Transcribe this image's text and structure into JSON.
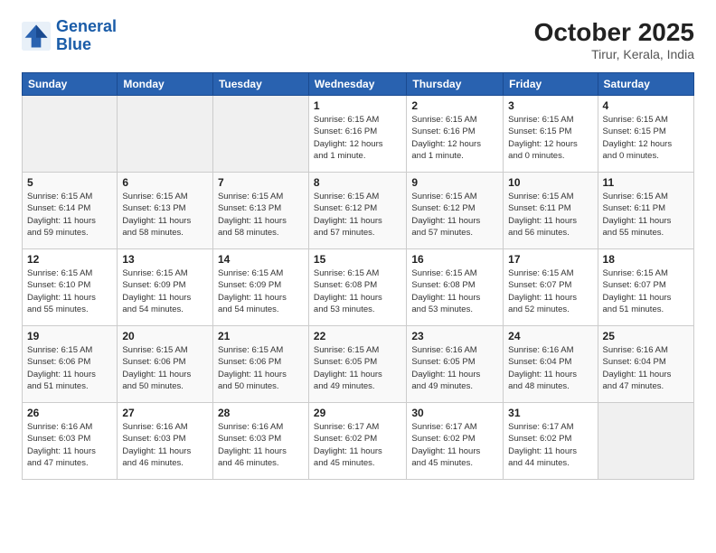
{
  "header": {
    "logo_line1": "General",
    "logo_line2": "Blue",
    "month": "October 2025",
    "location": "Tirur, Kerala, India"
  },
  "weekdays": [
    "Sunday",
    "Monday",
    "Tuesday",
    "Wednesday",
    "Thursday",
    "Friday",
    "Saturday"
  ],
  "weeks": [
    [
      {
        "day": "",
        "info": ""
      },
      {
        "day": "",
        "info": ""
      },
      {
        "day": "",
        "info": ""
      },
      {
        "day": "1",
        "info": "Sunrise: 6:15 AM\nSunset: 6:16 PM\nDaylight: 12 hours\nand 1 minute."
      },
      {
        "day": "2",
        "info": "Sunrise: 6:15 AM\nSunset: 6:16 PM\nDaylight: 12 hours\nand 1 minute."
      },
      {
        "day": "3",
        "info": "Sunrise: 6:15 AM\nSunset: 6:15 PM\nDaylight: 12 hours\nand 0 minutes."
      },
      {
        "day": "4",
        "info": "Sunrise: 6:15 AM\nSunset: 6:15 PM\nDaylight: 12 hours\nand 0 minutes."
      }
    ],
    [
      {
        "day": "5",
        "info": "Sunrise: 6:15 AM\nSunset: 6:14 PM\nDaylight: 11 hours\nand 59 minutes."
      },
      {
        "day": "6",
        "info": "Sunrise: 6:15 AM\nSunset: 6:13 PM\nDaylight: 11 hours\nand 58 minutes."
      },
      {
        "day": "7",
        "info": "Sunrise: 6:15 AM\nSunset: 6:13 PM\nDaylight: 11 hours\nand 58 minutes."
      },
      {
        "day": "8",
        "info": "Sunrise: 6:15 AM\nSunset: 6:12 PM\nDaylight: 11 hours\nand 57 minutes."
      },
      {
        "day": "9",
        "info": "Sunrise: 6:15 AM\nSunset: 6:12 PM\nDaylight: 11 hours\nand 57 minutes."
      },
      {
        "day": "10",
        "info": "Sunrise: 6:15 AM\nSunset: 6:11 PM\nDaylight: 11 hours\nand 56 minutes."
      },
      {
        "day": "11",
        "info": "Sunrise: 6:15 AM\nSunset: 6:11 PM\nDaylight: 11 hours\nand 55 minutes."
      }
    ],
    [
      {
        "day": "12",
        "info": "Sunrise: 6:15 AM\nSunset: 6:10 PM\nDaylight: 11 hours\nand 55 minutes."
      },
      {
        "day": "13",
        "info": "Sunrise: 6:15 AM\nSunset: 6:09 PM\nDaylight: 11 hours\nand 54 minutes."
      },
      {
        "day": "14",
        "info": "Sunrise: 6:15 AM\nSunset: 6:09 PM\nDaylight: 11 hours\nand 54 minutes."
      },
      {
        "day": "15",
        "info": "Sunrise: 6:15 AM\nSunset: 6:08 PM\nDaylight: 11 hours\nand 53 minutes."
      },
      {
        "day": "16",
        "info": "Sunrise: 6:15 AM\nSunset: 6:08 PM\nDaylight: 11 hours\nand 53 minutes."
      },
      {
        "day": "17",
        "info": "Sunrise: 6:15 AM\nSunset: 6:07 PM\nDaylight: 11 hours\nand 52 minutes."
      },
      {
        "day": "18",
        "info": "Sunrise: 6:15 AM\nSunset: 6:07 PM\nDaylight: 11 hours\nand 51 minutes."
      }
    ],
    [
      {
        "day": "19",
        "info": "Sunrise: 6:15 AM\nSunset: 6:06 PM\nDaylight: 11 hours\nand 51 minutes."
      },
      {
        "day": "20",
        "info": "Sunrise: 6:15 AM\nSunset: 6:06 PM\nDaylight: 11 hours\nand 50 minutes."
      },
      {
        "day": "21",
        "info": "Sunrise: 6:15 AM\nSunset: 6:06 PM\nDaylight: 11 hours\nand 50 minutes."
      },
      {
        "day": "22",
        "info": "Sunrise: 6:15 AM\nSunset: 6:05 PM\nDaylight: 11 hours\nand 49 minutes."
      },
      {
        "day": "23",
        "info": "Sunrise: 6:16 AM\nSunset: 6:05 PM\nDaylight: 11 hours\nand 49 minutes."
      },
      {
        "day": "24",
        "info": "Sunrise: 6:16 AM\nSunset: 6:04 PM\nDaylight: 11 hours\nand 48 minutes."
      },
      {
        "day": "25",
        "info": "Sunrise: 6:16 AM\nSunset: 6:04 PM\nDaylight: 11 hours\nand 47 minutes."
      }
    ],
    [
      {
        "day": "26",
        "info": "Sunrise: 6:16 AM\nSunset: 6:03 PM\nDaylight: 11 hours\nand 47 minutes."
      },
      {
        "day": "27",
        "info": "Sunrise: 6:16 AM\nSunset: 6:03 PM\nDaylight: 11 hours\nand 46 minutes."
      },
      {
        "day": "28",
        "info": "Sunrise: 6:16 AM\nSunset: 6:03 PM\nDaylight: 11 hours\nand 46 minutes."
      },
      {
        "day": "29",
        "info": "Sunrise: 6:17 AM\nSunset: 6:02 PM\nDaylight: 11 hours\nand 45 minutes."
      },
      {
        "day": "30",
        "info": "Sunrise: 6:17 AM\nSunset: 6:02 PM\nDaylight: 11 hours\nand 45 minutes."
      },
      {
        "day": "31",
        "info": "Sunrise: 6:17 AM\nSunset: 6:02 PM\nDaylight: 11 hours\nand 44 minutes."
      },
      {
        "day": "",
        "info": ""
      }
    ]
  ]
}
